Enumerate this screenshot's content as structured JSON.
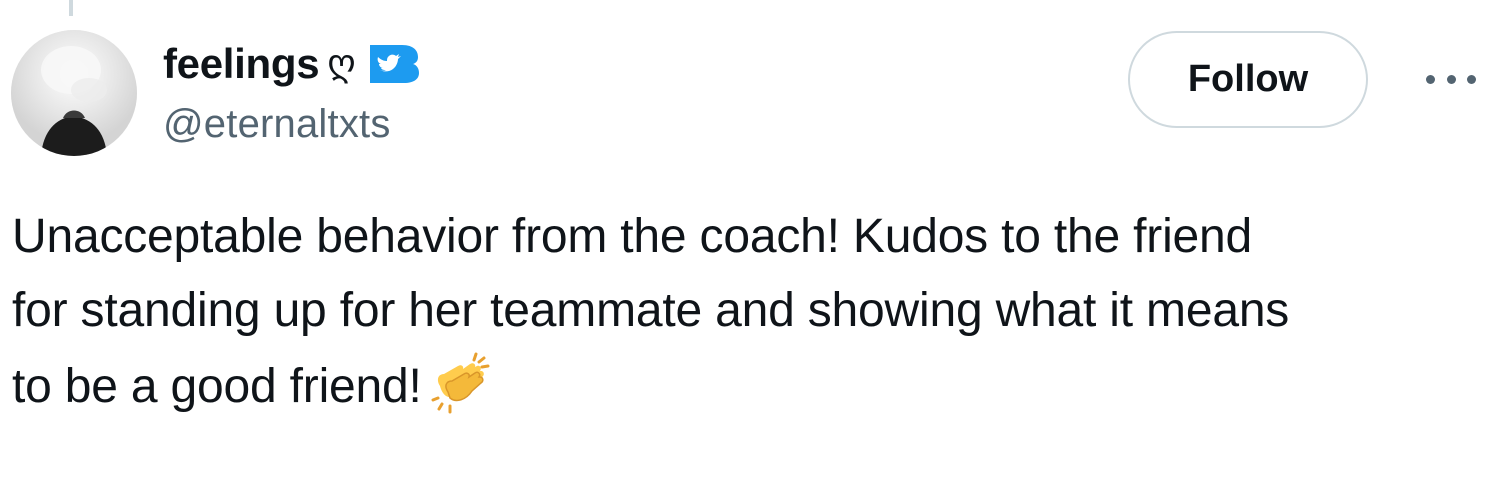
{
  "tweet": {
    "author": {
      "display_name": "feelings",
      "name_emoji": "ღ",
      "handle": "@eternaltxts",
      "verified": true,
      "avatar_icon": "smoke-avatar"
    },
    "follow_label": "Follow",
    "more_icon": "more-dots-icon",
    "text_lines": [
      "Unacceptable behavior from the coach! Kudos to the friend",
      "for standing up for her teammate and showing what it means",
      "to be a good friend!"
    ],
    "trailing_emoji": "clapping-hands-icon"
  },
  "colors": {
    "text_primary": "#0f1419",
    "text_secondary": "#536471",
    "border": "#cfd9de",
    "verified_blue": "#1d9bf0",
    "clap_yellow": "#ffcc4d"
  }
}
